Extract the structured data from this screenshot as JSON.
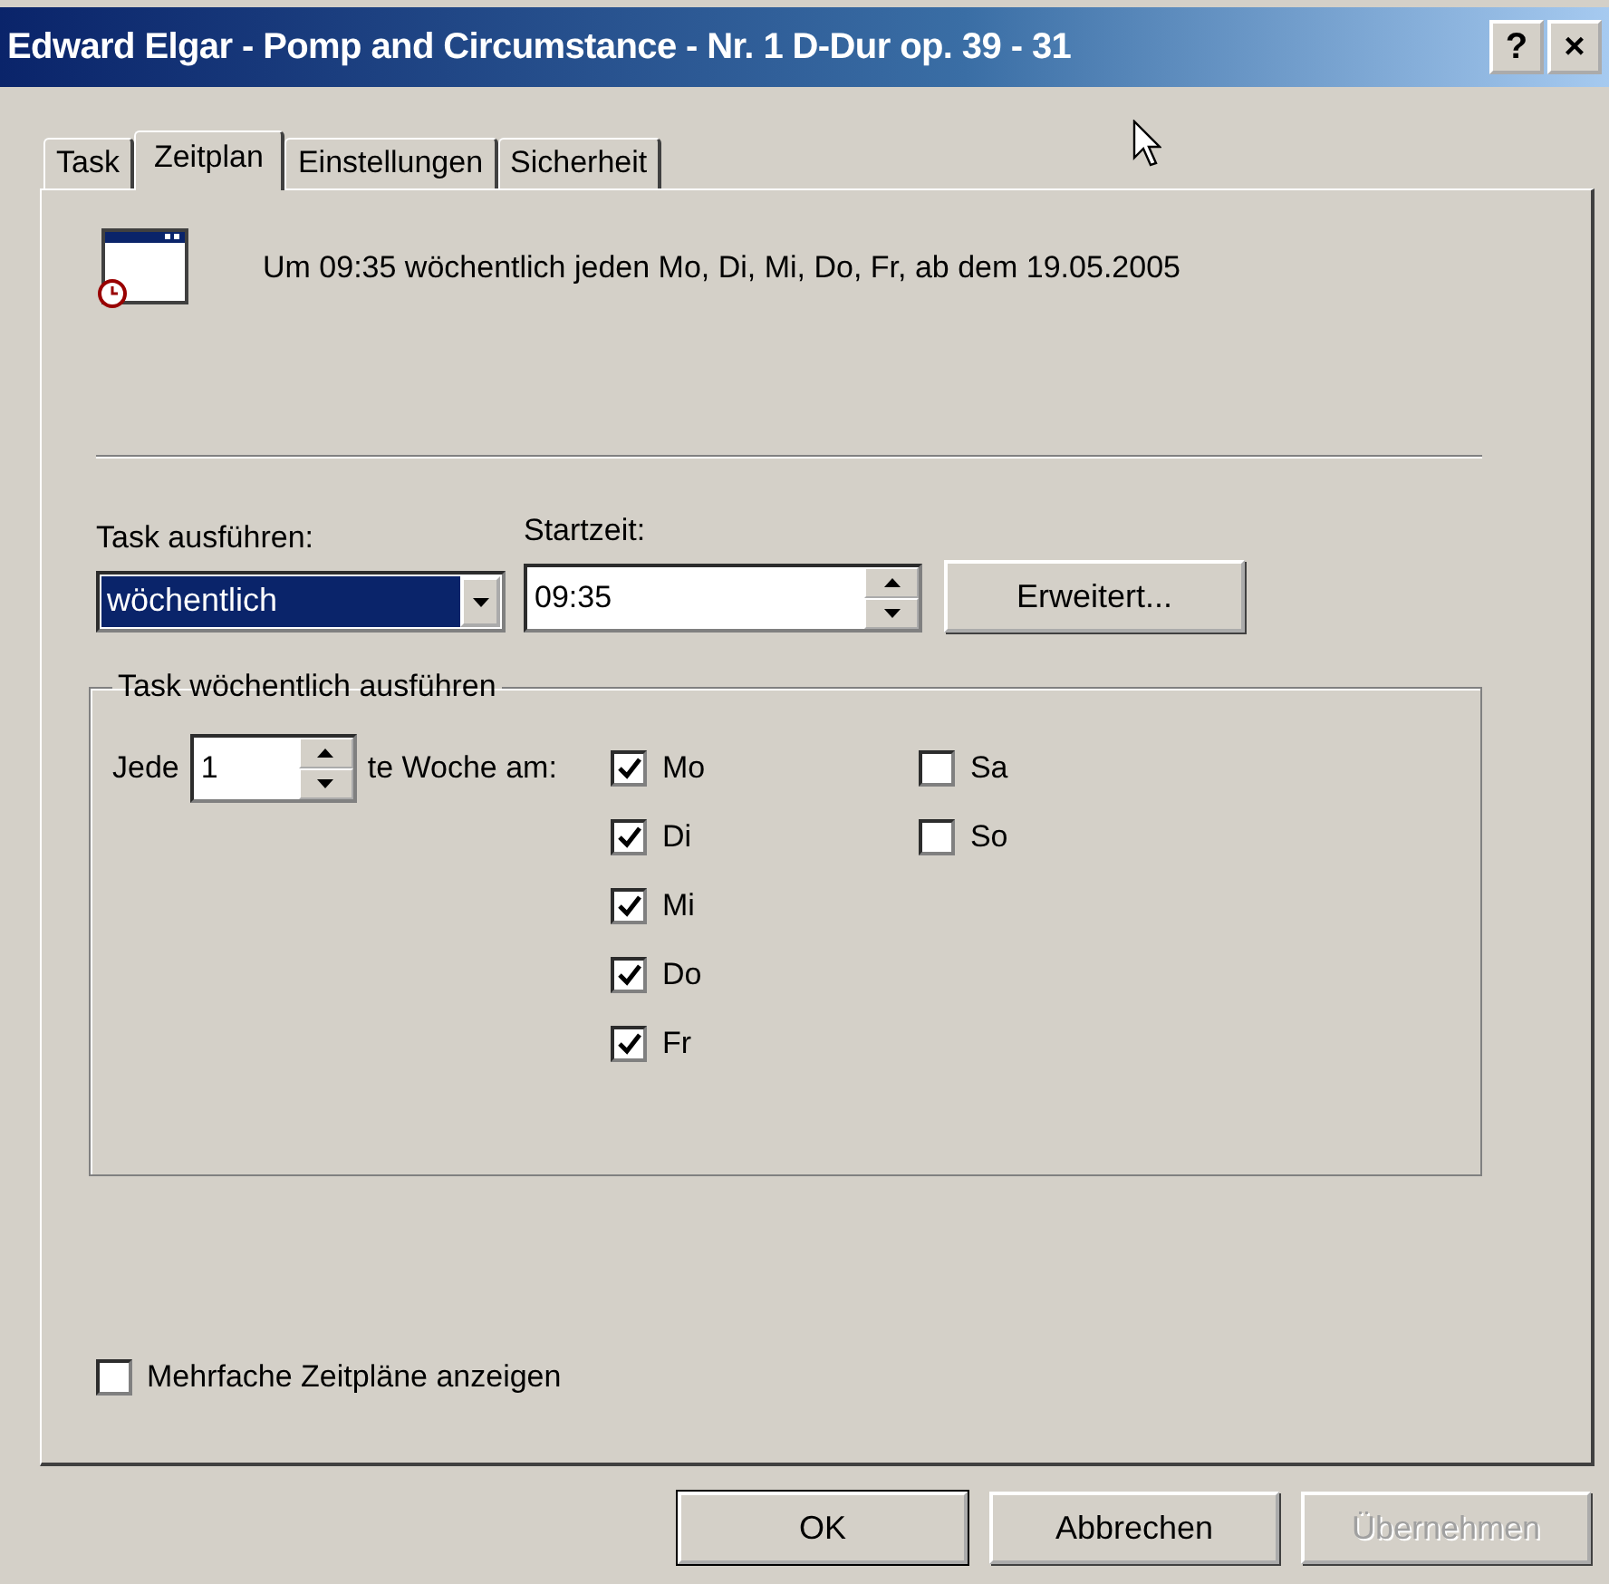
{
  "window": {
    "title": "Edward Elgar - Pomp and Circumstance - Nr. 1 D-Dur op. 39 -  31",
    "help": "?",
    "close": "×"
  },
  "tabs": [
    {
      "label": "Task",
      "selected": false
    },
    {
      "label": "Zeitplan",
      "selected": true
    },
    {
      "label": "Einstellungen",
      "selected": false
    },
    {
      "label": "Sicherheit",
      "selected": false
    }
  ],
  "summary": "Um 09:35 wöchentlich jeden Mo, Di, Mi, Do, Fr, ab dem 19.05.2005",
  "run_task": {
    "label": "Task ausführen:",
    "value": "wöchentlich"
  },
  "start_time": {
    "label": "Startzeit:",
    "value": "09:35"
  },
  "advanced_button": "Erweitert...",
  "weekly_group": {
    "title": "Task wöchentlich ausführen",
    "every_label": "Jede",
    "every_value": "1",
    "week_label": "te Woche am:",
    "weekdays": [
      {
        "label": "Mo",
        "checked": true
      },
      {
        "label": "Di",
        "checked": true
      },
      {
        "label": "Mi",
        "checked": true
      },
      {
        "label": "Do",
        "checked": true
      },
      {
        "label": "Fr",
        "checked": true
      }
    ],
    "weekend": [
      {
        "label": "Sa",
        "checked": false
      },
      {
        "label": "So",
        "checked": false
      }
    ]
  },
  "multiple_schedules": {
    "label": "Mehrfache Zeitpläne anzeigen",
    "checked": false
  },
  "buttons": [
    {
      "label": "OK",
      "disabled": false,
      "default": true
    },
    {
      "label": "Abbrechen",
      "disabled": false,
      "default": false
    },
    {
      "label": "Übernehmen",
      "disabled": true,
      "default": false
    }
  ]
}
